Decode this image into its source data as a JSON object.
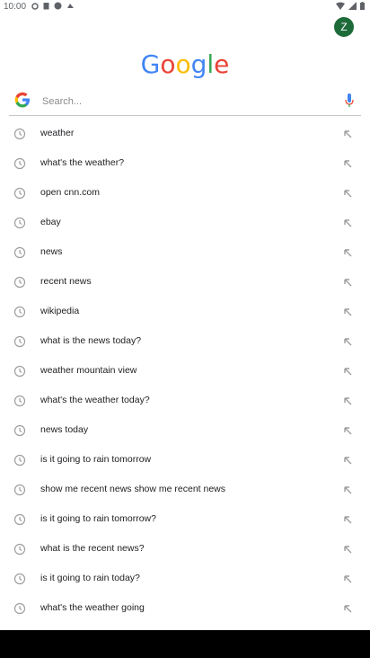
{
  "status_bar": {
    "time": "10:00"
  },
  "account": {
    "initial": "Z"
  },
  "logo": {
    "letters": [
      "G",
      "o",
      "o",
      "g",
      "l",
      "e"
    ],
    "colors": [
      "#4285F4",
      "#EA4335",
      "#FBBC05",
      "#4285F4",
      "#34A853",
      "#EA4335"
    ]
  },
  "search": {
    "placeholder": "Search..."
  },
  "suggestions": [
    {
      "label": "weather"
    },
    {
      "label": "what's the weather?"
    },
    {
      "label": "open cnn.com"
    },
    {
      "label": "ebay"
    },
    {
      "label": "news"
    },
    {
      "label": "recent news"
    },
    {
      "label": "wikipedia"
    },
    {
      "label": "what is the news today?"
    },
    {
      "label": "weather mountain view"
    },
    {
      "label": "what's the weather today?"
    },
    {
      "label": "news today"
    },
    {
      "label": "is it going to rain tomorrow"
    },
    {
      "label": "show me recent news show me recent news"
    },
    {
      "label": "is it going to rain tomorrow?"
    },
    {
      "label": "what is the recent news?"
    },
    {
      "label": "is it going to rain today?"
    },
    {
      "label": "what's the weather going"
    }
  ],
  "icons": {
    "history": "history-clock-icon",
    "fill": "arrow-up-left-icon",
    "mic": "microphone-icon",
    "google": "google-g-icon"
  }
}
